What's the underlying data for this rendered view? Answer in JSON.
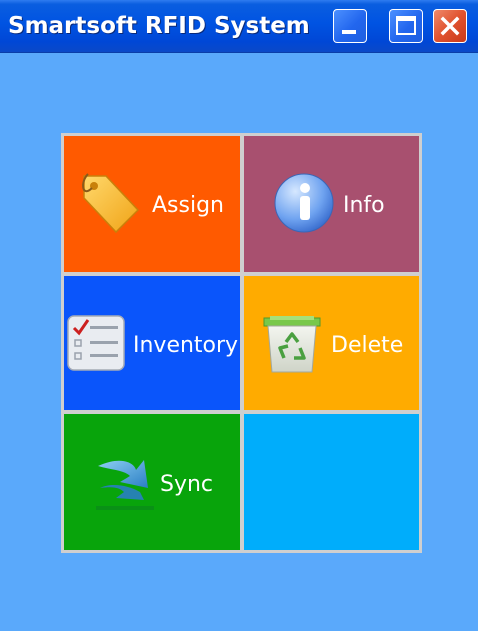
{
  "window": {
    "title": "Smartsoft RFID System",
    "background": "#5aa9fb",
    "controls": [
      "minimize",
      "maximize",
      "close"
    ]
  },
  "tiles": [
    {
      "label": "Assign",
      "icon": "tag-icon",
      "color": "#ff5a00"
    },
    {
      "label": "Info",
      "icon": "info-icon",
      "color": "#a8506f"
    },
    {
      "label": "Inventory",
      "icon": "checklist-icon",
      "color": "#0a55fb"
    },
    {
      "label": "Delete",
      "icon": "recycle-bin-icon",
      "color": "#ffab00"
    },
    {
      "label": "Sync",
      "icon": "sync-arrow-icon",
      "color": "#08a40b"
    },
    {
      "label": "",
      "icon": "",
      "color": "#00adfb"
    }
  ]
}
